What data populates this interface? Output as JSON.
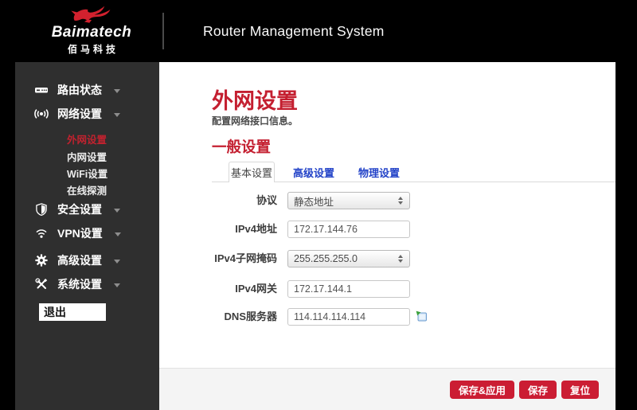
{
  "header": {
    "brand": {
      "name": "Baimatech",
      "cn": "佰马科技"
    },
    "title": "Router Management System"
  },
  "sidebar": {
    "items": [
      {
        "label": "路由状态",
        "icon": "router-status-icon"
      },
      {
        "label": "网络设置",
        "icon": "network-broadcast-icon",
        "children": [
          {
            "label": "外网设置",
            "active": true
          },
          {
            "label": "内网设置"
          },
          {
            "label": "WiFi设置"
          },
          {
            "label": "在线探测"
          }
        ]
      },
      {
        "label": "安全设置",
        "icon": "shield-icon"
      },
      {
        "label": "VPN设置",
        "icon": "vpn-signal-icon"
      },
      {
        "label": "高级设置",
        "icon": "gear-icon"
      },
      {
        "label": "系统设置",
        "icon": "tools-icon"
      }
    ],
    "logout": "退出"
  },
  "main": {
    "title": "外网设置",
    "subtitle": "配置网络接口信息。",
    "section": "一般设置",
    "tabs": [
      {
        "label": "基本设置",
        "active": true
      },
      {
        "label": "高级设置",
        "active": false
      },
      {
        "label": "物理设置",
        "active": false
      }
    ],
    "form": {
      "rows": [
        {
          "label": "协议",
          "type": "select",
          "value": "静态地址"
        },
        {
          "label": "IPv4地址",
          "type": "text",
          "value": "172.17.144.76"
        },
        {
          "label": "IPv4子网掩码",
          "type": "select",
          "value": "255.255.255.0"
        },
        {
          "label": "IPv4网关",
          "type": "text",
          "value": "172.17.144.1"
        },
        {
          "label": "DNS服务器",
          "type": "text",
          "value": "114.114.114.114",
          "add_icon": "add-entry-icon"
        }
      ]
    },
    "footer_buttons": [
      {
        "label": "保存&应用"
      },
      {
        "label": "保存"
      },
      {
        "label": "复位"
      }
    ]
  },
  "colors": {
    "accent_red": "#c41f30",
    "button_red": "#cb1d33",
    "link_blue": "#2343c8",
    "sidebar_bg": "#2f2f2f",
    "header_bg": "#000000",
    "footer_bg": "#f4f4f4",
    "active_submenu_red": "#c0222f"
  }
}
